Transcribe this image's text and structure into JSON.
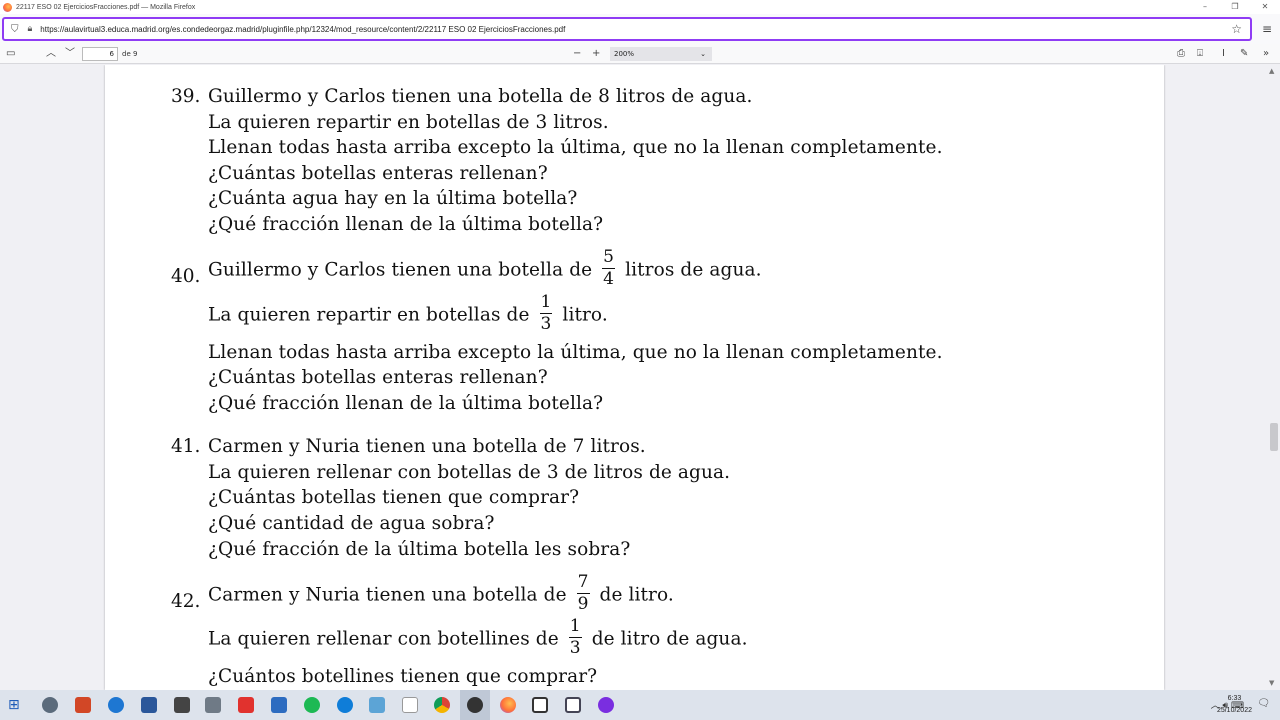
{
  "window": {
    "title": "22117 ESO 02 EjerciciosFracciones.pdf — Mozilla Firefox"
  },
  "browser": {
    "url": "https://aulavirtual3.educa.madrid.org/es.condedeorgaz.madrid/pluginfile.php/12324/mod_resource/content/2/22117 ESO 02 EjerciciosFracciones.pdf"
  },
  "pdf_toolbar": {
    "page_number": "6",
    "page_count": "de 9",
    "zoom": "200%"
  },
  "problems": [
    {
      "number": "39.",
      "lines": [
        "Guillermo y Carlos tienen una botella de 8 litros de agua.",
        "La quieren repartir en botellas de 3 litros.",
        "Llenan todas hasta arriba excepto la última, que no la llenan completamente.",
        "¿Cuántas botellas enteras rellenan?",
        "¿Cuánta agua hay en la última botella?",
        "¿Qué fracción llenan de la última botella?"
      ]
    },
    {
      "number": "40.",
      "line1_pre": "Guillermo y Carlos tienen una botella de",
      "line1_num": "5",
      "line1_den": "4",
      "line1_post": "litros de agua.",
      "line2_pre": "La quieren repartir en botellas de",
      "line2_num": "1",
      "line2_den": "3",
      "line2_post": "litro.",
      "lines": [
        "Llenan todas hasta arriba excepto la última, que no la llenan completamente.",
        "¿Cuántas botellas enteras rellenan?",
        "¿Qué fracción llenan de la última botella?"
      ]
    },
    {
      "number": "41.",
      "lines": [
        "Carmen y Nuria tienen una botella de 7 litros.",
        "La quieren rellenar con botellas de 3 de litros de agua.",
        "¿Cuántas botellas tienen que comprar?",
        "¿Qué cantidad de agua sobra?",
        "¿Qué fracción de la última botella les sobra?"
      ]
    },
    {
      "number": "42.",
      "line1_pre": "Carmen y Nuria tienen una botella de",
      "line1_num": "7",
      "line1_den": "9",
      "line1_post": "de litro.",
      "line2_pre": "La quieren rellenar con botellines de",
      "line2_num": "1",
      "line2_den": "3",
      "line2_post": "de litro de agua.",
      "lines": [
        "¿Cuántos botellines tienen que comprar?"
      ]
    }
  ],
  "taskbar": {
    "time": "6:33",
    "date": "25/10/2022"
  },
  "colors": {
    "url_focus": "#8f3cf4",
    "page_bg": "#ffffff",
    "viewer_bg": "#f0f0f4",
    "taskbar_bg": "#dde3ec"
  }
}
